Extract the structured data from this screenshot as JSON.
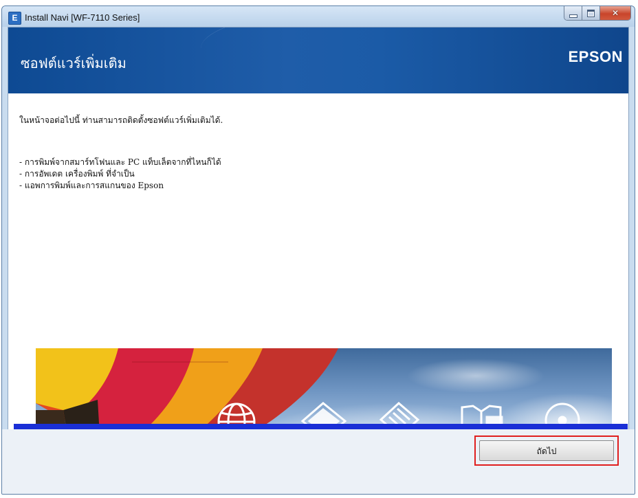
{
  "window": {
    "title": "Install Navi [WF-7110 Series]",
    "app_icon_letter": "E"
  },
  "header": {
    "title": "ซอฟต์แวร์เพิ่มเติม",
    "brand": "EPSON"
  },
  "content": {
    "intro": "ในหน้าจอต่อไปนี้ ท่านสามารถติดตั้งซอฟต์แวร์เพิ่มเติมได้.",
    "items": [
      "- การพิมพ์จากสมาร์ทโฟนและ PC แท็บเล็ตจากที่ไหนก็ได้",
      "- การอัพเดต เครื่องพิมพ์ ที่จำเป็น",
      "- แอพการพิมพ์และการสแกนของ Epson"
    ]
  },
  "banner": {
    "icons": [
      "globe-icon",
      "photo-stack-icon",
      "documents-icon",
      "manual-monitor-icon",
      "disc-icon"
    ]
  },
  "footer": {
    "next_label": "ถัดไป"
  },
  "colors": {
    "header_blue": "#1b5ba7",
    "divider_blue": "#1a2fd6",
    "highlight_red": "#e01e1e"
  }
}
